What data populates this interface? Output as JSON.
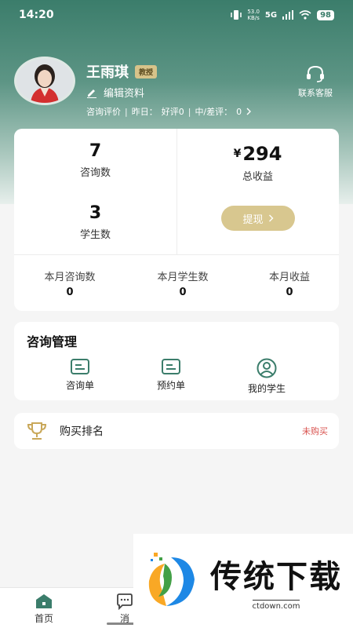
{
  "status_bar": {
    "time": "14:20",
    "net_speed_value": "53.0",
    "net_speed_unit": "KB/s",
    "signal_label": "5G",
    "battery": "98"
  },
  "profile": {
    "name": "王雨琪",
    "badge": "教授",
    "edit_label": "编辑资料",
    "review_label": "咨询评价",
    "yesterday_label": "昨日：",
    "good_label": "好评0",
    "bad_label": "中/差评：",
    "bad_count": "0",
    "service_label": "联系客服"
  },
  "stats": {
    "consult_count": "7",
    "consult_label": "咨询数",
    "student_count": "3",
    "student_label": "学生数",
    "income_symbol": "¥",
    "income_total": "294",
    "income_label": "总收益",
    "withdraw_label": "提现",
    "month_consult_label": "本月咨询数",
    "month_consult_value": "0",
    "month_student_label": "本月学生数",
    "month_student_value": "0",
    "month_income_label": "本月收益",
    "month_income_value": "0"
  },
  "manage": {
    "title": "咨询管理",
    "items": [
      {
        "label": "咨询单",
        "icon": "document-icon"
      },
      {
        "label": "预约单",
        "icon": "document-icon"
      },
      {
        "label": "我的学生",
        "icon": "person-icon"
      }
    ]
  },
  "rank": {
    "label": "购买排名",
    "status": "未购买",
    "status_color": "#d9534f"
  },
  "tabbar": {
    "home_label": "首页",
    "message_label": "消"
  },
  "watermark": {
    "title": "传统下载",
    "url": "ctdown.com"
  },
  "colors": {
    "accent": "#3b7d6b",
    "gold": "#d8c78f"
  }
}
